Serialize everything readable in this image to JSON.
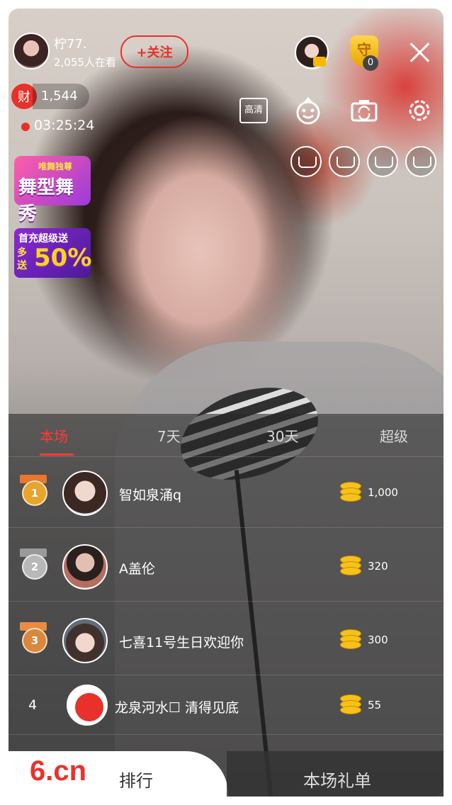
{
  "anchor": {
    "name": "柠77.",
    "viewers": "2,055人在看",
    "follow_label": "+关注"
  },
  "wealth": {
    "icon_label": "财",
    "value": "1,544"
  },
  "live": {
    "time": "03:25:24"
  },
  "promos": {
    "dance": {
      "line1": "唯舞独尊",
      "line2": "舞型舞秀"
    },
    "recharge": {
      "line1": "首充超级送",
      "line2": "多送",
      "line3": "50%"
    }
  },
  "top_right": {
    "guard_label": "守",
    "guard_count": "0"
  },
  "controls": {
    "hd_label": "高清"
  },
  "tabs": [
    {
      "label": "本场"
    },
    {
      "label": "7天"
    },
    {
      "label": "30天"
    },
    {
      "label": "超级"
    }
  ],
  "ranking": [
    {
      "rank": "1",
      "name": "智如泉涌q",
      "amount": "1,000"
    },
    {
      "rank": "2",
      "name": "A盖伦",
      "amount": "320"
    },
    {
      "rank": "3",
      "name": "七喜11号生日欢迎你",
      "amount": "300"
    },
    {
      "rank": "4",
      "name": "龙泉河水☐ 清得见底",
      "amount": "55"
    }
  ],
  "bottom": {
    "logo": "6.cn",
    "left_label": "排行",
    "right_label": "本场礼单"
  },
  "colors": {
    "accent": "#e7312a",
    "tab_active": "#ff3b30",
    "coin": "#f6c11a"
  }
}
